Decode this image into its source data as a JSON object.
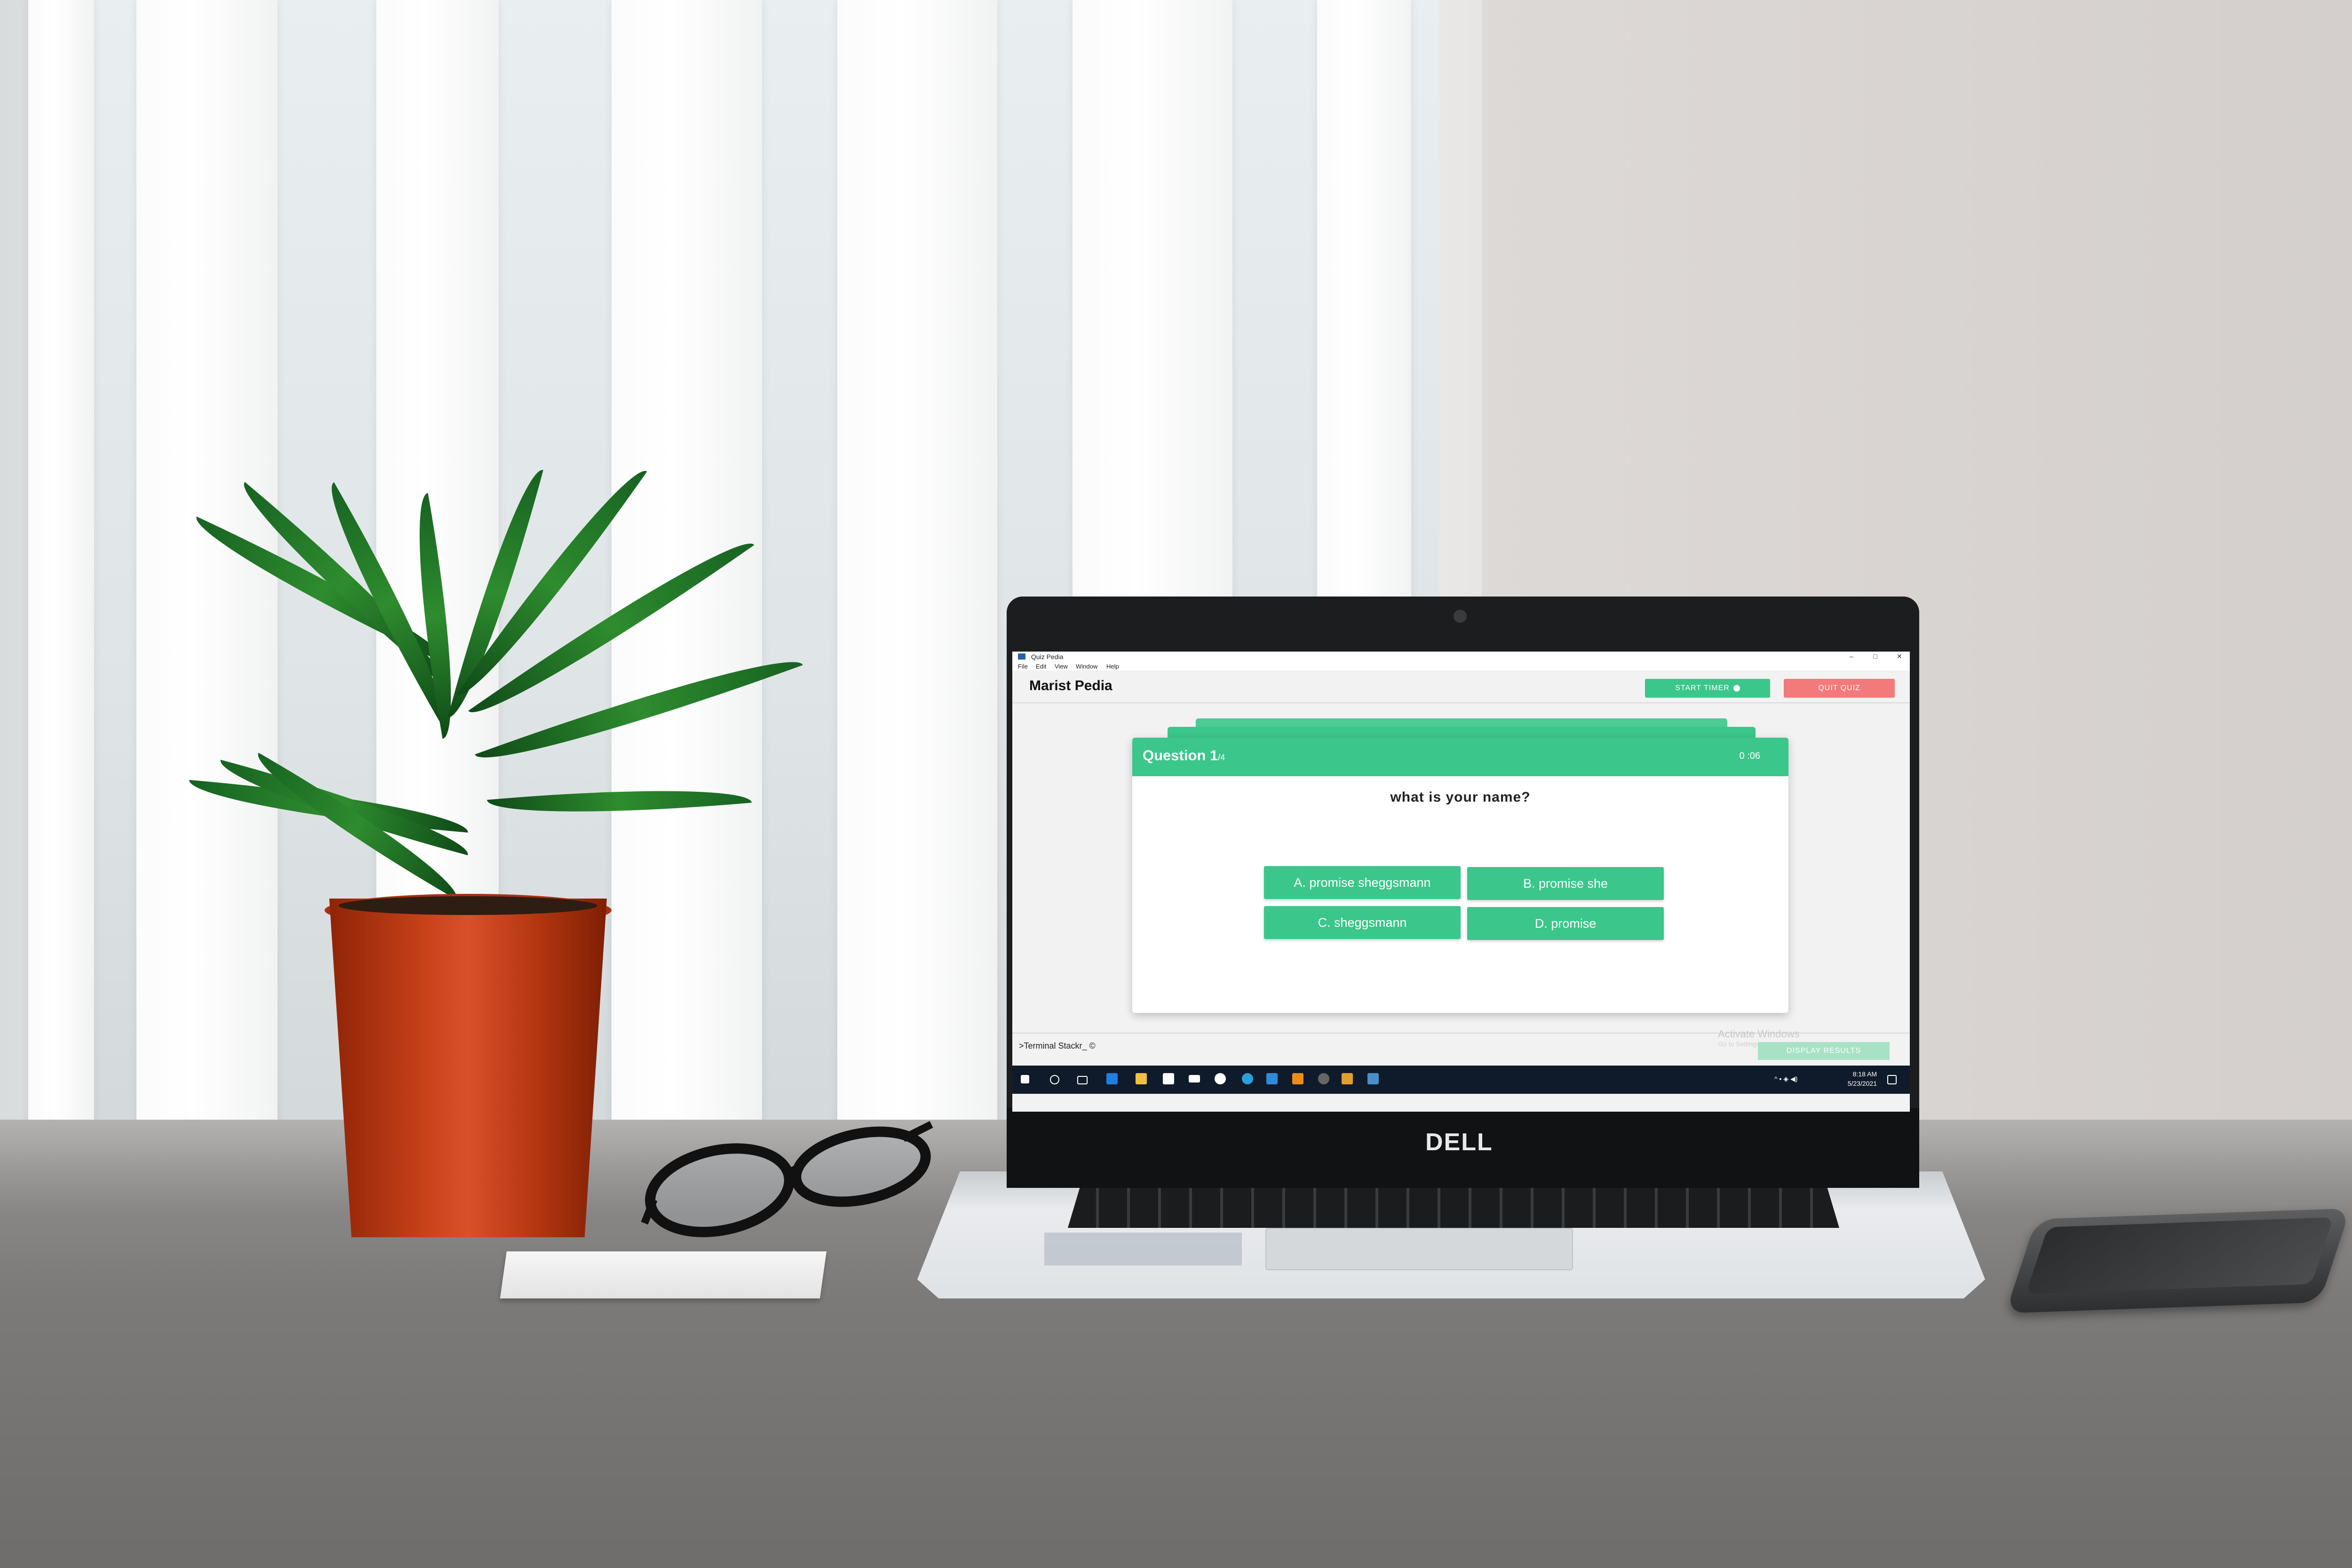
{
  "app": {
    "window_title": "Quiz Pedia",
    "menu": [
      "File",
      "Edit",
      "View",
      "Window",
      "Help"
    ],
    "window_controls": [
      "–",
      "□",
      "✕"
    ]
  },
  "header": {
    "brand": "Marist Pedia",
    "start_timer_label": "START TIMER",
    "quit_quiz_label": "QUIT QUIZ"
  },
  "quiz": {
    "question_label": "Question 1",
    "question_count": "/4",
    "timer": "0 :06",
    "question_text": "what is your name?",
    "options": [
      "A. promise sheggsmann",
      "B. promise she",
      "C. sheggsmann",
      "D. promise"
    ]
  },
  "footer": {
    "terminal_text": ">Terminal Stackr_ ©",
    "display_results_label": "DISPLAY RESULTS",
    "watermark_title": "Activate Windows",
    "watermark_sub": "Go to Settings"
  },
  "taskbar": {
    "time": "8:18 AM",
    "date": "5/23/2021",
    "icons": [
      "windows-start-icon",
      "search-icon",
      "task-view-icon",
      "edge-icon",
      "file-explorer-icon",
      "store-icon",
      "mail-icon",
      "settings-icon",
      "browser-icon",
      "vscode-icon",
      "vlc-icon",
      "app-icon",
      "app-icon",
      "app-icon"
    ]
  },
  "laptop": {
    "brand": "DELL"
  },
  "colors": {
    "accent_green": "#3bc68b",
    "quit_red": "#f27a7a",
    "results_green_disabled": "#a8e2c6",
    "taskbar": "#0f1b2a"
  }
}
